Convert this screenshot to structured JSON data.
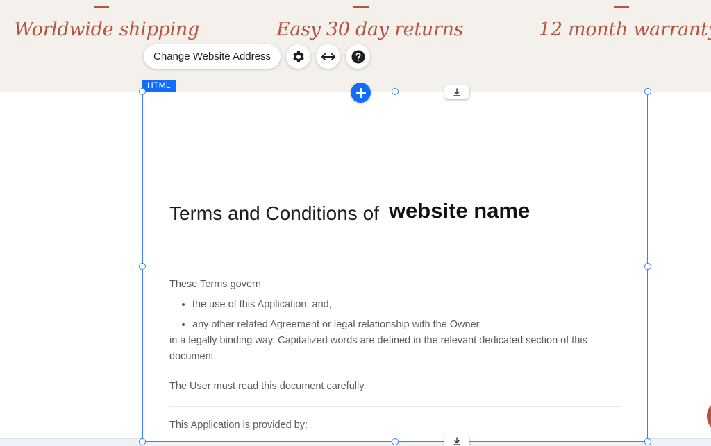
{
  "features": [
    {
      "label": "Worldwide shipping"
    },
    {
      "label": "Easy 30 day returns"
    },
    {
      "label": "12 month warranty"
    }
  ],
  "toolbar": {
    "change_address_label": "Change Website Address",
    "icons": [
      "gear-icon",
      "stretch-arrows-icon",
      "help-icon"
    ]
  },
  "element_label": "HTML",
  "document": {
    "title": "Terms and Conditions of",
    "site_name": "website name",
    "intro": "These Terms govern",
    "bullets": [
      "the use of this Application, and,",
      "any other related Agreement or legal relationship with the Owner"
    ],
    "after_bullets": "in a legally binding way. Capitalized words are defined in the relevant dedicated section of this document.",
    "read_notice": "The User must read this document carefully.",
    "provided_by": "This Application is provided by:"
  },
  "colors": {
    "accent": "#b5533c",
    "editor_blue": "#116dff",
    "band_bg": "#f4f1ed"
  }
}
